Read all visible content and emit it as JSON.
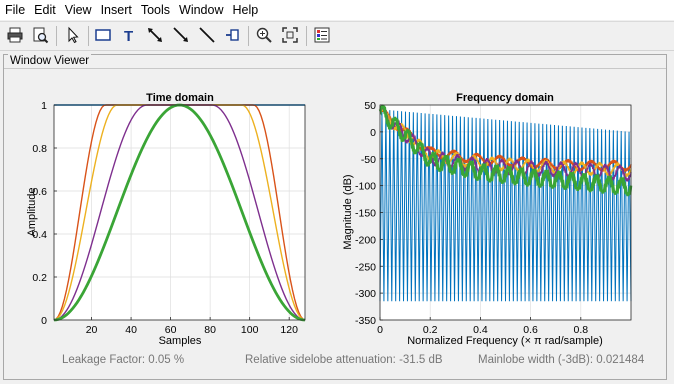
{
  "menu": [
    "File",
    "Edit",
    "View",
    "Insert",
    "Tools",
    "Window",
    "Help"
  ],
  "toolbar_icons": [
    "print-icon",
    "print-preview-icon",
    "pointer-icon",
    "rectangle-icon",
    "text-icon",
    "double-arrow-icon",
    "arrow-icon",
    "line-icon",
    "pin-icon",
    "zoom-in-icon",
    "fit-icon",
    "legend-icon"
  ],
  "panel_title": "Window Viewer",
  "time_plot": {
    "title": "Time domain",
    "xlabel": "Samples",
    "ylabel": "Amplitude",
    "xticks": [
      "20",
      "40",
      "60",
      "80",
      "100",
      "120"
    ],
    "yticks": [
      "0",
      "0.2",
      "0.4",
      "0.6",
      "0.8",
      "1"
    ]
  },
  "freq_plot": {
    "title": "Frequency domain",
    "xlabel": "Normalized Frequency  (× π rad/sample)",
    "ylabel": "Magnitude (dB)",
    "xticks": [
      "0",
      "0.2",
      "0.4",
      "0.6",
      "0.8"
    ],
    "yticks": [
      "50",
      "0",
      "-50",
      "-100",
      "-150",
      "-200",
      "-250",
      "-300",
      "-350"
    ]
  },
  "status": {
    "leakage": "Leakage Factor: 0.05 %",
    "sidelobe": "Relative sidelobe attenuation: -31.5 dB",
    "mainlobe": "Mainlobe width (-3dB): 0.021484"
  },
  "chart_data": [
    {
      "type": "line",
      "title": "Time domain",
      "xlabel": "Samples",
      "ylabel": "Amplitude",
      "xlim": [
        1,
        128
      ],
      "ylim": [
        0,
        1
      ],
      "series": [
        {
          "color": "#0072bd",
          "x": [
            1,
            128
          ],
          "y": [
            1,
            1
          ]
        },
        {
          "color": "#d95319",
          "x": [
            1,
            14,
            27,
            102,
            115,
            128
          ],
          "y": [
            0,
            0.5,
            1,
            1,
            0.5,
            0
          ]
        },
        {
          "color": "#edb120",
          "x": [
            1,
            17,
            33,
            96,
            112,
            128
          ],
          "y": [
            0,
            0.5,
            1,
            1,
            0.5,
            0
          ]
        },
        {
          "color": "#7e2f8e",
          "x": [
            1,
            24,
            48,
            81,
            105,
            128
          ],
          "y": [
            0,
            0.5,
            1,
            1,
            0.5,
            0
          ]
        },
        {
          "color": "#3aa536",
          "x": [
            1,
            33,
            64.5,
            96,
            128
          ],
          "y": [
            0,
            0.5,
            1,
            0.5,
            0
          ]
        }
      ]
    },
    {
      "type": "line",
      "title": "Frequency domain",
      "xlabel": "Normalized Frequency  (× π rad/sample)",
      "ylabel": "Magnitude (dB)",
      "xlim": [
        0,
        1
      ],
      "ylim": [
        -350,
        50
      ],
      "series": [
        {
          "color": "#0072bd",
          "x": [
            0,
            1
          ],
          "y_upper": [
            42,
            0
          ],
          "y_floor": [
            -315,
            -315
          ]
        },
        {
          "color": "#d95319",
          "x": [
            0,
            0.2,
            0.4,
            0.6,
            0.8,
            1
          ],
          "y": [
            42,
            -35,
            -48,
            -55,
            -60,
            -60
          ]
        },
        {
          "color": "#edb120",
          "x": [
            0,
            0.2,
            0.4,
            0.6,
            0.8,
            1
          ],
          "y": [
            42,
            -40,
            -55,
            -60,
            -65,
            -68
          ]
        },
        {
          "color": "#7e2f8e",
          "x": [
            0,
            0.2,
            0.4,
            0.6,
            0.8,
            1
          ],
          "y": [
            42,
            -45,
            -60,
            -65,
            -68,
            -75
          ]
        },
        {
          "color": "#3aa536",
          "x": [
            0,
            0.2,
            0.4,
            0.6,
            0.8,
            1
          ],
          "y": [
            42,
            -50,
            -72,
            -82,
            -90,
            -100
          ]
        }
      ]
    }
  ]
}
